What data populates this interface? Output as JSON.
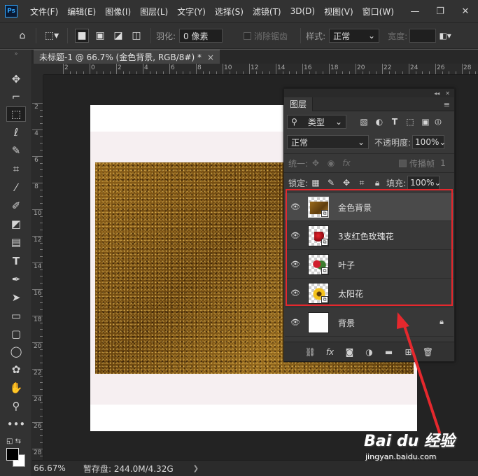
{
  "app": {
    "logo": "Ps",
    "menus": [
      "文件(F)",
      "编辑(E)",
      "图像(I)",
      "图层(L)",
      "文字(Y)",
      "选择(S)",
      "滤镜(T)",
      "3D(D)",
      "视图(V)",
      "窗口(W)"
    ],
    "window_controls": [
      "—",
      "❐",
      "✕"
    ]
  },
  "options": {
    "feather_label": "羽化:",
    "feather_value": "0 像素",
    "antialias_label": "消除锯齿",
    "style_label": "样式:",
    "style_value": "正常",
    "width_label": "宽度:"
  },
  "document": {
    "tab_title": "未标题-1 @ 66.7% (金色背景, RGB/8#) *",
    "close": "×"
  },
  "rulers": {
    "top": [
      "2",
      "0",
      "2",
      "4",
      "6",
      "8",
      "10",
      "12",
      "14",
      "16",
      "18",
      "20",
      "22",
      "24",
      "26",
      "28"
    ],
    "left": [
      "2",
      "4",
      "6",
      "8",
      "10",
      "12",
      "14",
      "16",
      "18",
      "20",
      "22",
      "24",
      "26",
      "28"
    ]
  },
  "layers_panel": {
    "tab": "图层",
    "filter_kind": "类型",
    "blend_mode": "正常",
    "opacity_label": "不透明度:",
    "opacity_value": "100%",
    "unify_label": "统一:",
    "propagate_label": "传播帧",
    "propagate_value": "1",
    "lock_label": "锁定:",
    "fill_label": "填充:",
    "fill_value": "100%",
    "layers": [
      {
        "name": "金色背景",
        "selected": true,
        "thumb": "gold"
      },
      {
        "name": "3支红色玫瑰花",
        "selected": false,
        "thumb": "roses"
      },
      {
        "name": "叶子",
        "selected": false,
        "thumb": "leaf"
      },
      {
        "name": "太阳花",
        "selected": false,
        "thumb": "sun"
      },
      {
        "name": "背景",
        "selected": false,
        "thumb": "white",
        "locked": true
      }
    ],
    "footer_icons": [
      "link-icon",
      "fx-icon",
      "mask-icon",
      "adjustment-icon",
      "folder-icon",
      "new-layer-icon",
      "trash-icon"
    ]
  },
  "status": {
    "zoom": "66.67%",
    "scratch": "暂存盘: 244.0M/4.32G",
    "arrow": "❯"
  },
  "watermark": {
    "brand": "Bai du 经验",
    "url": "jingyan.baidu.com"
  },
  "colors": {
    "annotation": "#e5282d",
    "ps_blue": "#31a8ff"
  }
}
